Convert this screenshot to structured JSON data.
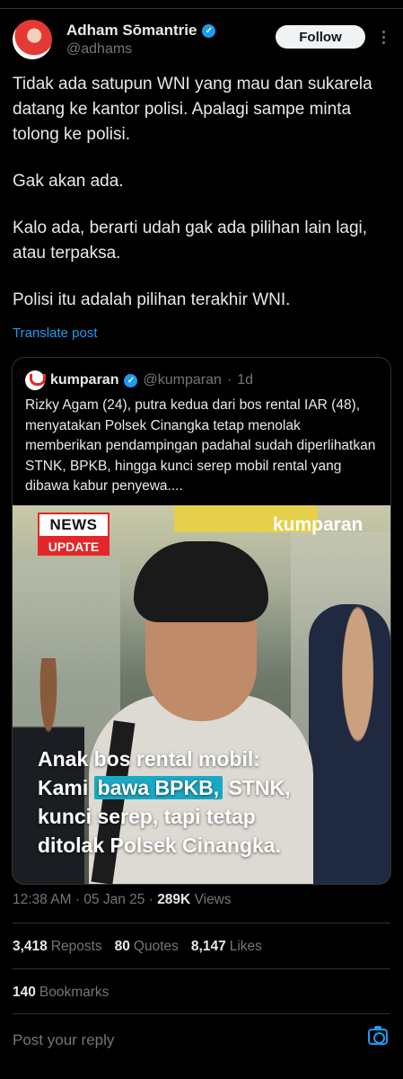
{
  "author": {
    "name": "Adham Sōmantrie",
    "handle": "@adhams",
    "follow_label": "Follow",
    "verified_icon": "verified-badge-icon",
    "more_icon": "more-options-icon"
  },
  "post": {
    "paragraphs": [
      "Tidak ada satupun WNI yang mau dan sukarela datang ke kantor polisi. Apalagi sampe minta tolong ke polisi.",
      "Gak akan ada.",
      "Kalo ada, berarti udah gak ada pilihan lain lagi, atau terpaksa.",
      "Polisi itu adalah pilihan terakhir WNI."
    ],
    "translate_label": "Translate post"
  },
  "quote": {
    "name": "kumparan",
    "handle": "@kumparan",
    "separator": "·",
    "time": "1d",
    "text": "Rizky Agam (24), putra kedua dari bos rental IAR (48), menyatakan Polsek Cinangka tetap menolak memberikan pendampingan padahal sudah diperlihatkan STNK, BPKB, hingga kunci serep mobil rental yang dibawa kabur penyewa....",
    "image": {
      "badge_top": "NEWS",
      "badge_bottom": "UPDATE",
      "watermark": "kumparan",
      "caption_line1": "Anak bos rental mobil:",
      "caption_line2_pre": "Kami ",
      "caption_line2_hl": "bawa BPKB,",
      "caption_line2_post": " STNK,",
      "caption_line3": "kunci serep, tapi tetap",
      "caption_line4": "ditolak Polsek Cinangka."
    }
  },
  "meta": {
    "time": "12:38 AM",
    "dot": "·",
    "date": "05 Jan 25",
    "views_count": "289K",
    "views_label": "Views"
  },
  "stats": {
    "reposts_count": "3,418",
    "reposts_label": "Reposts",
    "quotes_count": "80",
    "quotes_label": "Quotes",
    "likes_count": "8,147",
    "likes_label": "Likes",
    "bookmarks_count": "140",
    "bookmarks_label": "Bookmarks"
  },
  "reply": {
    "placeholder": "Post your reply",
    "camera_icon": "camera-icon"
  },
  "colors": {
    "background": "#000000",
    "accent": "#1d9bf0",
    "text": "#e7e9ea",
    "muted": "#71767b"
  }
}
